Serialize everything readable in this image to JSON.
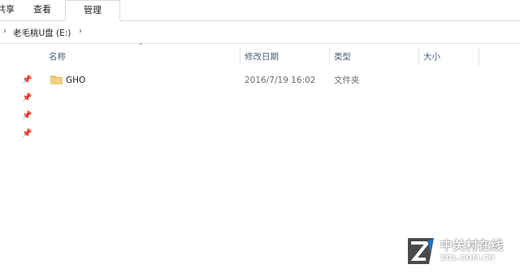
{
  "ribbon": {
    "tabs": [
      {
        "label": "共享"
      },
      {
        "label": "查看"
      },
      {
        "label": "管理"
      }
    ]
  },
  "address": {
    "crumb": "老毛桃U盘 (E:)"
  },
  "columns": {
    "name": "名称",
    "date": "修改日期",
    "type": "类型",
    "size": "大小"
  },
  "files": [
    {
      "name": "GHO",
      "modified": "2016/7/19 16:02",
      "type": "文件夹",
      "size": "",
      "icon": "folder-icon"
    }
  ],
  "quick_access_pins": [
    "pin-icon",
    "pin-icon",
    "pin-icon",
    "pin-icon"
  ],
  "watermark": {
    "cn": "中关村在线",
    "en": "ZOL.COM.CN"
  },
  "colors": {
    "header_text": "#4c607a",
    "folder": "#e8c26b",
    "watermark_blue": "#1e73be"
  }
}
